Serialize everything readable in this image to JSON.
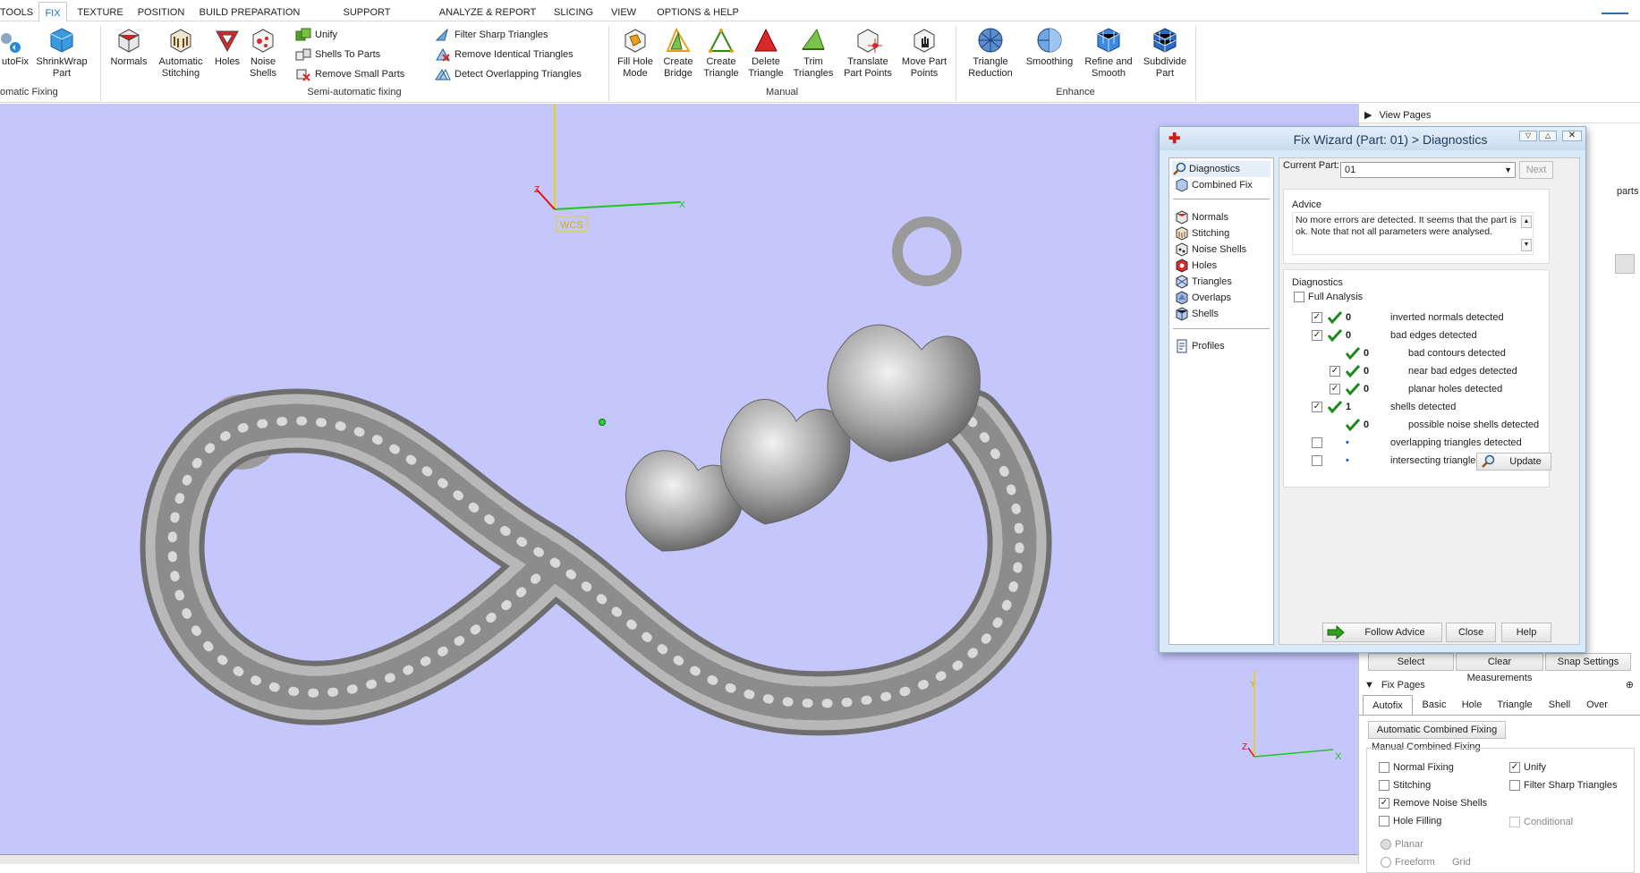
{
  "menu": {
    "tabs": [
      "TOOLS",
      "FIX",
      "TEXTURE",
      "POSITION",
      "BUILD PREPARATION",
      "SUPPORT GENERATION",
      "ANALYZE & REPORT",
      "SLICING",
      "VIEW",
      "OPTIONS & HELP"
    ],
    "active_tab": "FIX"
  },
  "ribbon": {
    "autofix": "utoFix",
    "shrinkwrap": [
      "ShrinkWrap",
      "Part"
    ],
    "group_automatic": "omatic Fixing",
    "normals": "Normals",
    "auto_stitching": [
      "Automatic",
      "Stitching"
    ],
    "holes": "Holes",
    "noise_shells": [
      "Noise",
      "Shells"
    ],
    "unify": "Unify",
    "shells_to_parts": "Shells To Parts",
    "remove_small_parts": "Remove Small Parts",
    "group_semi": "Semi-automatic fixing",
    "filter_sharp": "Filter Sharp Triangles",
    "remove_identical": "Remove Identical Triangles",
    "detect_overlapping": "Detect Overlapping Triangles",
    "fill_hole": [
      "Fill Hole",
      "Mode"
    ],
    "create_bridge": [
      "Create",
      "Bridge"
    ],
    "create_triangle": [
      "Create",
      "Triangle"
    ],
    "delete_triangle": [
      "Delete",
      "Triangle"
    ],
    "trim_triangles": [
      "Trim",
      "Triangles"
    ],
    "translate_points": [
      "Translate",
      "Part Points"
    ],
    "move_points": [
      "Move Part",
      "Points"
    ],
    "group_manual": "Manual",
    "triangle_reduction": [
      "Triangle",
      "Reduction"
    ],
    "smoothing": "Smoothing",
    "refine_smooth": [
      "Refine and",
      "Smooth"
    ],
    "subdivide": [
      "Subdivide",
      "Part"
    ],
    "group_enhance": "Enhance"
  },
  "viewport": {
    "wcs_label": "WCS",
    "axis_x": "X",
    "axis_y": "Y",
    "axis_z": "Z",
    "background": "#c5c6fb"
  },
  "right_panel": {
    "view_pages": "View Pages",
    "parts_fragment": "parts",
    "buttons": {
      "select": "Select",
      "clear_measurements": "Clear Measurements",
      "snap_settings": "Snap Settings"
    },
    "fix_pages": "Fix Pages",
    "tabs": [
      "Autofix",
      "Basic",
      "Hole",
      "Triangle",
      "Shell",
      "Over"
    ],
    "active_tab": "Autofix",
    "automatic_combined": "Automatic Combined Fixing",
    "manual_combined": "Manual Combined Fixing",
    "options": [
      {
        "label": "Normal Fixing",
        "checked": false
      },
      {
        "label": "Unify",
        "checked": true
      },
      {
        "label": "Stitching",
        "checked": false
      },
      {
        "label": "Filter Sharp Triangles",
        "checked": false
      },
      {
        "label": "Remove Noise Shells",
        "checked": true
      },
      {
        "label": "Hole Filling",
        "checked": false
      },
      {
        "label": "Conditional",
        "checked": false
      }
    ],
    "planar": "Planar",
    "freeform": "Freeform",
    "grid": "Grid"
  },
  "wizard": {
    "title": "Fix Wizard (Part: 01) > Diagnostics",
    "nav": [
      "Diagnostics",
      "Combined Fix",
      "Normals",
      "Stitching",
      "Noise Shells",
      "Holes",
      "Triangles",
      "Overlaps",
      "Shells",
      "Profiles"
    ],
    "current_part_label": "Current Part:",
    "current_part_value": "01",
    "next": "Next",
    "advice_title": "Advice",
    "advice_text": "No more errors are detected. It seems that the part is ok. Note that not all parameters were analysed.",
    "diagnostics_title": "Diagnostics",
    "full_analysis": "Full Analysis",
    "rows": [
      {
        "checked": true,
        "ok": true,
        "count": "0",
        "label": "inverted normals detected",
        "indent": 0
      },
      {
        "checked": true,
        "ok": true,
        "count": "0",
        "label": "bad edges detected",
        "indent": 0
      },
      {
        "checked": null,
        "ok": true,
        "count": "0",
        "label": "bad contours detected",
        "indent": 1
      },
      {
        "checked": true,
        "ok": true,
        "count": "0",
        "label": "near bad edges detected",
        "indent": 1
      },
      {
        "checked": true,
        "ok": true,
        "count": "0",
        "label": "planar holes detected",
        "indent": 1
      },
      {
        "checked": true,
        "ok": true,
        "count": "1",
        "label": "shells detected",
        "indent": 0
      },
      {
        "checked": null,
        "ok": true,
        "count": "0",
        "label": "possible noise shells detected",
        "indent": 1
      },
      {
        "checked": false,
        "ok": false,
        "count": "•",
        "label": "overlapping triangles detected",
        "indent": 0
      },
      {
        "checked": false,
        "ok": false,
        "count": "•",
        "label": "intersecting triangles detected",
        "indent": 0
      }
    ],
    "update": "Update",
    "follow_advice": "Follow Advice",
    "close": "Close",
    "help": "Help"
  }
}
